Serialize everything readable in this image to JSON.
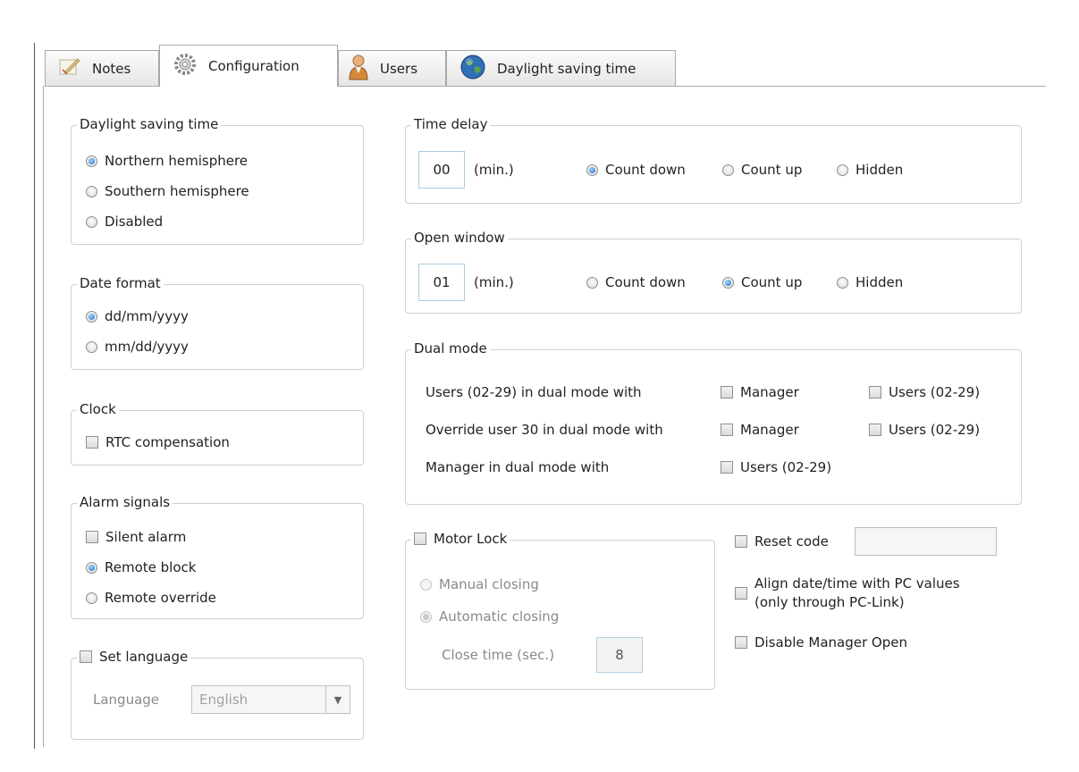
{
  "tabs": [
    {
      "label": "Notes",
      "icon": "notes-icon"
    },
    {
      "label": "Configuration",
      "icon": "gear-icon"
    },
    {
      "label": "Users",
      "icon": "user-icon"
    },
    {
      "label": "Daylight saving time",
      "icon": "globe-icon"
    }
  ],
  "active_tab": "Configuration",
  "daylight": {
    "title": "Daylight saving time",
    "options": [
      "Northern hemisphere",
      "Southern hemisphere",
      "Disabled"
    ],
    "selected": "Northern hemisphere"
  },
  "date_format": {
    "title": "Date format",
    "options": [
      "dd/mm/yyyy",
      "mm/dd/yyyy"
    ],
    "selected": "dd/mm/yyyy"
  },
  "clock": {
    "title": "Clock",
    "rtc_label": "RTC compensation",
    "rtc_checked": false
  },
  "alarm": {
    "title": "Alarm signals",
    "silent_label": "Silent alarm",
    "silent_checked": false,
    "options": [
      "Remote block",
      "Remote override"
    ],
    "selected": "Remote block"
  },
  "language": {
    "title": "Set language",
    "checked": false,
    "label": "Language",
    "value": "English"
  },
  "time_delay": {
    "title": "Time delay",
    "value": "00",
    "unit": "(min.)",
    "options": [
      "Count down",
      "Count up",
      "Hidden"
    ],
    "selected": "Count down"
  },
  "open_window": {
    "title": "Open window",
    "value": "01",
    "unit": "(min.)",
    "options": [
      "Count down",
      "Count up",
      "Hidden"
    ],
    "selected": "Count up"
  },
  "dual_mode": {
    "title": "Dual mode",
    "row1_label": "Users (02-29) in dual mode with",
    "row2_label": "Override user 30 in dual mode with",
    "row3_label": "Manager in dual mode with",
    "manager": "Manager",
    "users": "Users (02-29)"
  },
  "motor_lock": {
    "title": "Motor Lock",
    "checked": false,
    "options": [
      "Manual closing",
      "Automatic closing"
    ],
    "selected": "Automatic closing",
    "close_time_label": "Close time (sec.)",
    "close_time_value": "8"
  },
  "misc": {
    "reset_code_label": "Reset code",
    "reset_code_value": "",
    "align_label_1": "Align date/time with PC values",
    "align_label_2": "(only through PC-Link)",
    "disable_manager_label": "Disable Manager Open"
  },
  "colors": {
    "radio_selected": "#1b6fc6",
    "border": "#cfcfcf",
    "input_border": "#a9cbe0"
  }
}
